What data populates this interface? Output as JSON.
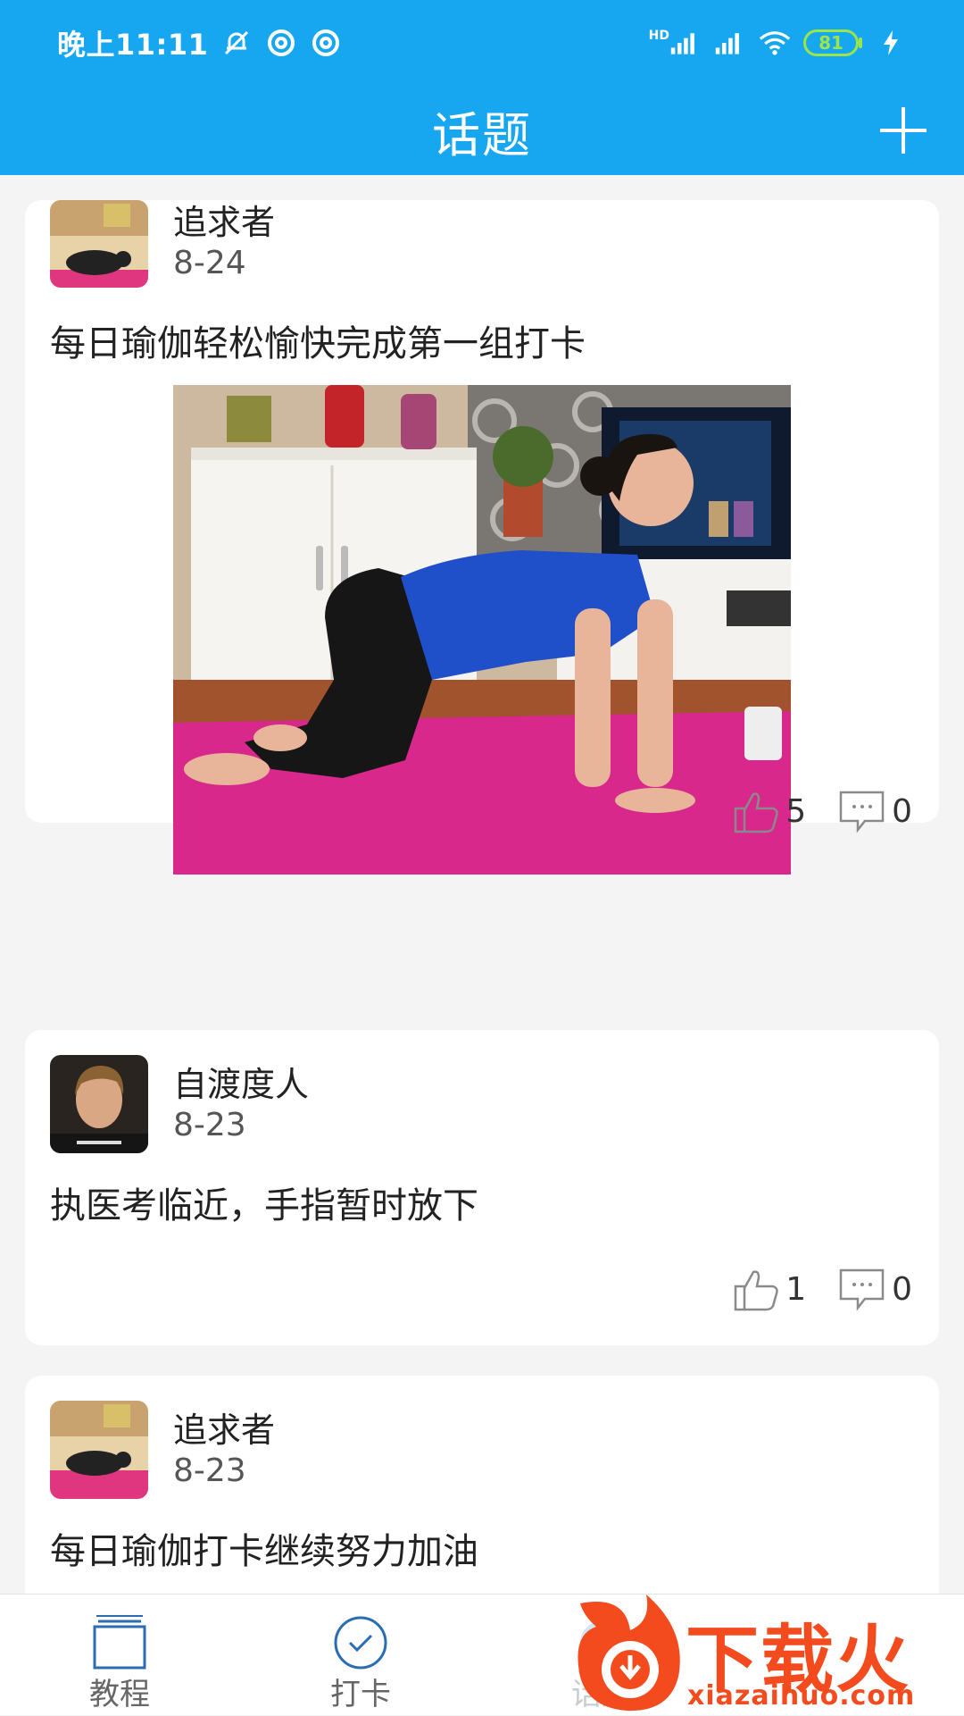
{
  "status_bar": {
    "time": "晚上11:11",
    "hd": "HD",
    "battery": "81"
  },
  "header": {
    "title": "话题"
  },
  "posts": [
    {
      "user": "追求者",
      "date": "8-24",
      "text": "每日瑜伽轻松愉快完成第一组打卡",
      "likes": "5",
      "comments": "0"
    },
    {
      "user": "自渡度人",
      "date": "8-23",
      "text": "执医考临近，手指暂时放下",
      "likes": "1",
      "comments": "0"
    },
    {
      "user": "追求者",
      "date": "8-23",
      "text": "每日瑜伽打卡继续努力加油"
    }
  ],
  "tabs": [
    {
      "label": "教程"
    },
    {
      "label": "打卡"
    },
    {
      "label": "话题"
    }
  ],
  "watermark": {
    "brand": "下载火",
    "url": "xiazaihuo.com"
  },
  "colors": {
    "primary": "#16a7f0",
    "mat": "#d9288c",
    "shirt": "#1f4fc9",
    "watermark": "#f34b1d"
  }
}
